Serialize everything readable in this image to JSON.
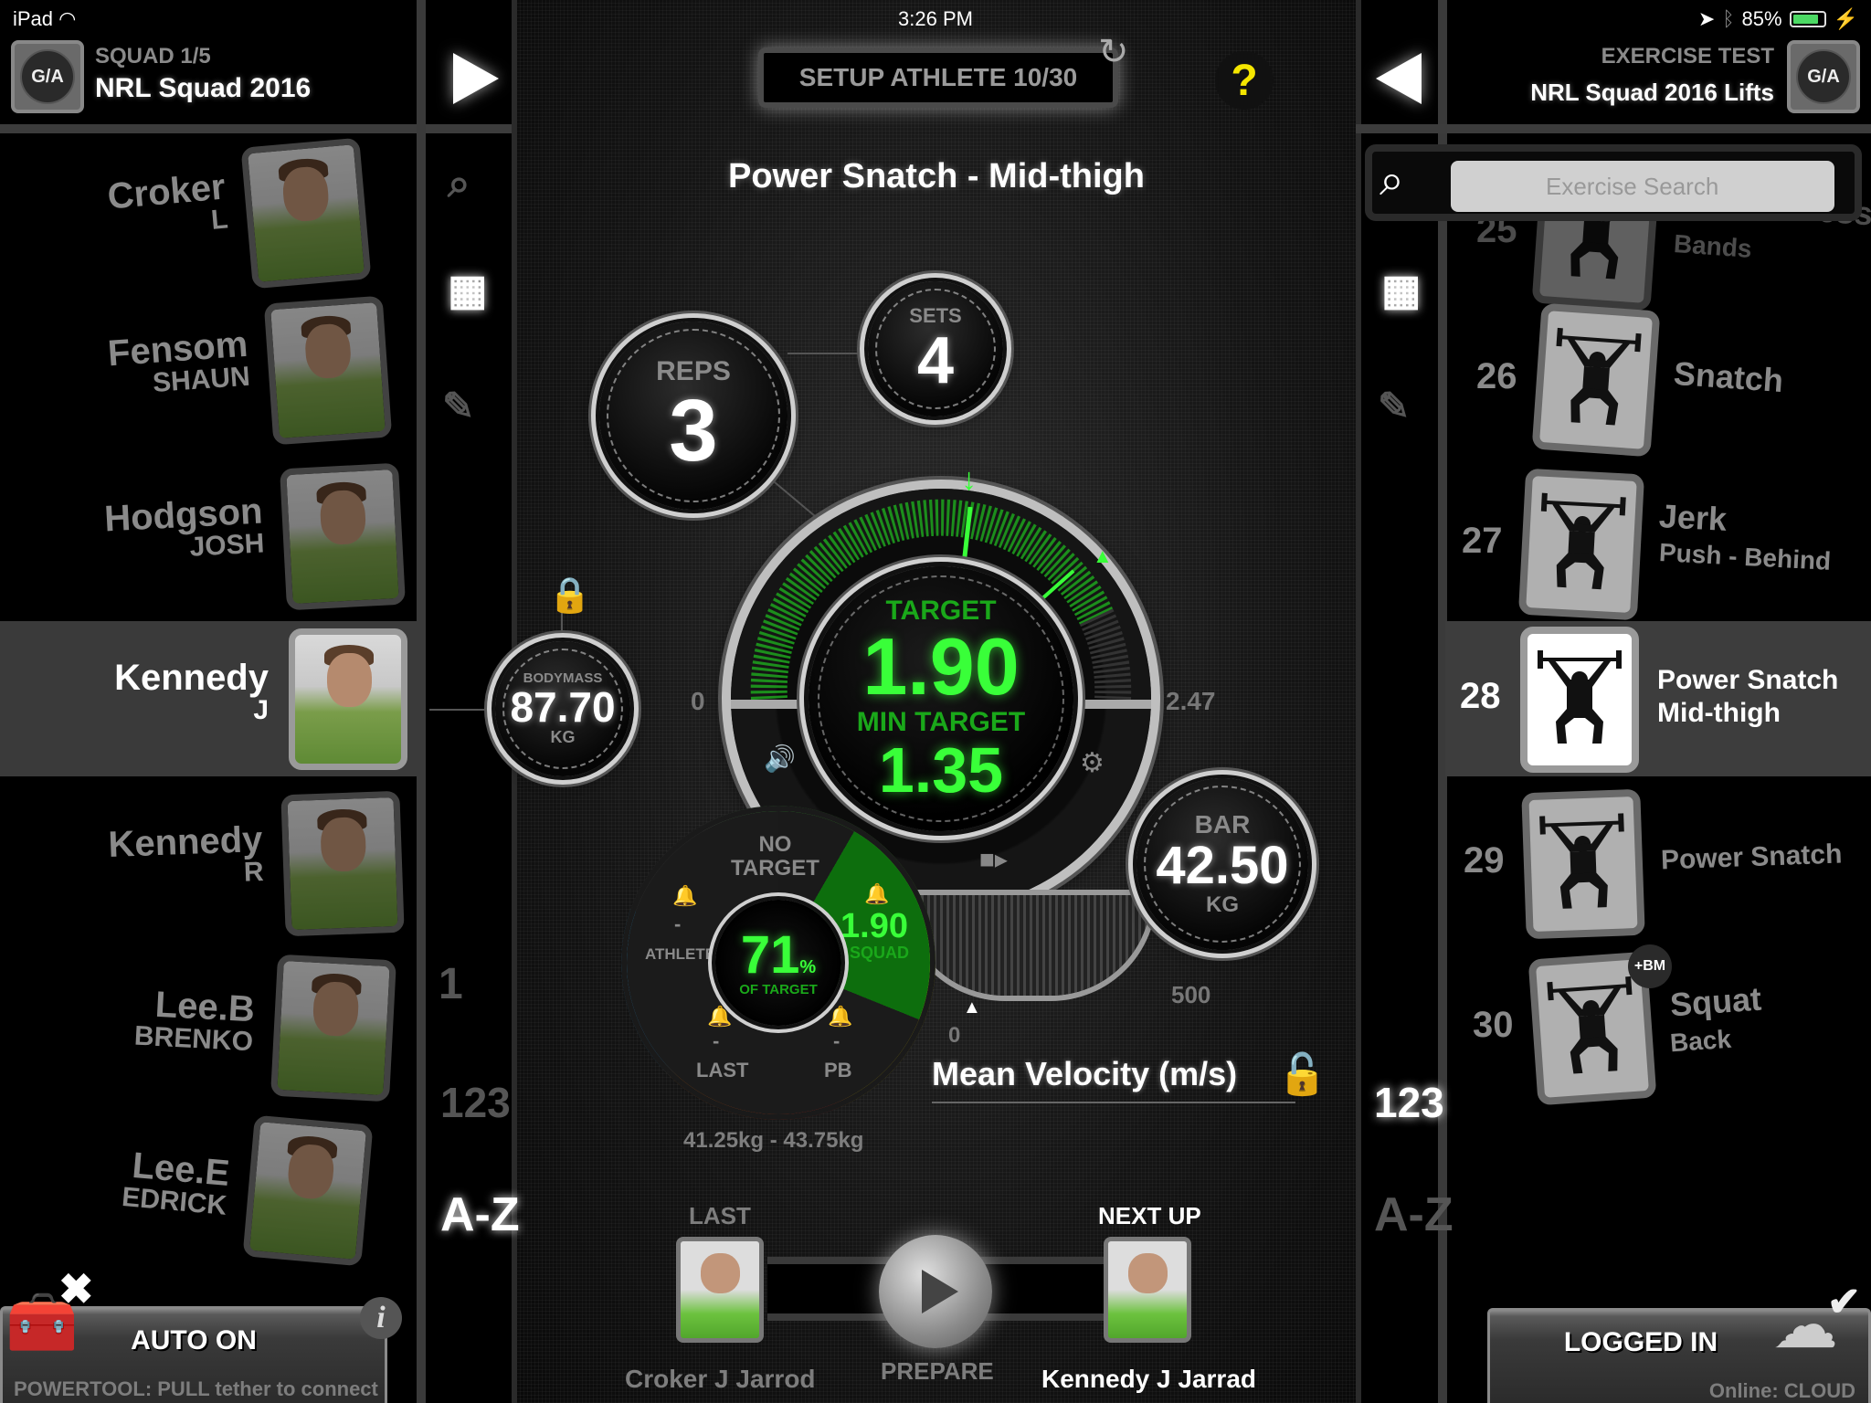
{
  "status_bar": {
    "device": "iPad",
    "time": "3:26 PM",
    "battery_percent": "85%",
    "battery_level": 0.85,
    "icons": [
      "wifi-icon",
      "location-icon",
      "bluetooth-icon",
      "battery-icon",
      "charging-icon"
    ]
  },
  "left_header": {
    "logo": "G/A",
    "subtitle": "SQUAD 1/5",
    "title": "NRL Squad 2016"
  },
  "right_header": {
    "logo": "G/A",
    "subtitle": "EXERCISE TEST",
    "title": "NRL Squad 2016 Lifts"
  },
  "athletes": [
    {
      "surname": "Croker",
      "given": "L",
      "selected": false
    },
    {
      "surname": "Fensom",
      "given": "SHAUN",
      "selected": false
    },
    {
      "surname": "Hodgson",
      "given": "JOSH",
      "selected": false
    },
    {
      "surname": "Kennedy",
      "given": "J",
      "selected": true
    },
    {
      "surname": "Kennedy",
      "given": "R",
      "selected": false
    },
    {
      "surname": "Lee.B",
      "given": "BRENKO",
      "selected": false
    },
    {
      "surname": "Lee.E",
      "given": "EDRICK",
      "selected": false
    }
  ],
  "left_tools": {
    "search": "search-icon",
    "grid": "grid-view-icon",
    "edit": "edit-list-icon",
    "jersey_number": "1",
    "sort_numeric": "123",
    "sort_alpha": "A-Z"
  },
  "right_tools": {
    "grid": "grid-view-icon",
    "edit": "edit-list-icon",
    "sort_numeric": "123",
    "sort_alpha": "A-Z"
  },
  "setup": {
    "button_label": "SETUP ATHLETE 10/30",
    "help": "?"
  },
  "exercise_title": "Power Snatch - Mid-thigh",
  "reps": {
    "label": "REPS",
    "value": "3"
  },
  "sets": {
    "label": "SETS",
    "value": "4"
  },
  "bodymass": {
    "label": "BODYMASS",
    "value": "87.70",
    "unit": "KG"
  },
  "main_gauge": {
    "target_label": "TARGET",
    "target_value": "1.90",
    "min_target_label": "MIN TARGET",
    "min_target_value": "1.35",
    "scale_min": "0",
    "scale_max": "2.47"
  },
  "bar": {
    "label": "BAR",
    "value": "42.50",
    "unit": "KG",
    "scale_min": "0",
    "scale_max": "500"
  },
  "target_wheel": {
    "percent": "71",
    "percent_sign": "%",
    "percent_label": "OF TARGET",
    "segments": {
      "no_target": "NO\nTARGET",
      "athlete_label": "ATHLETE",
      "athlete_value": "-",
      "squad_label": "SQUAD",
      "squad_value": "1.90",
      "last_label": "LAST",
      "last_value": "-",
      "pb_label": "PB",
      "pb_value": "-"
    },
    "range": "41.25kg - 43.75kg"
  },
  "metric_label": "Mean Velocity (m/s)",
  "bottom_nav": {
    "last_label": "LAST",
    "last_name": "Croker J Jarrod",
    "prepare_label": "PREPARE",
    "next_label": "NEXT UP",
    "next_name": "Kennedy J Jarrad"
  },
  "powertool": {
    "title": "AUTO ON",
    "subtitle": "POWERTOOL: PULL tether to connect",
    "info": "i"
  },
  "login": {
    "title": "LOGGED IN",
    "subtitle": "Online: CLOUD"
  },
  "search": {
    "placeholder": "Exercise Search",
    "value": ""
  },
  "exercises": [
    {
      "num": "25",
      "name": "Bench Press",
      "sub": "Bands",
      "selected": false
    },
    {
      "num": "26",
      "name": "Snatch",
      "sub": "",
      "selected": false
    },
    {
      "num": "27",
      "name": "Jerk",
      "sub": "Push - Behind",
      "selected": false
    },
    {
      "num": "28",
      "name": "Power Snatch",
      "sub": "Mid-thigh",
      "selected": true
    },
    {
      "num": "29",
      "name": "Power Snatch",
      "sub": "",
      "selected": false
    },
    {
      "num": "30",
      "name": "Squat",
      "sub": "Back",
      "selected": false,
      "badge": "+BM"
    }
  ]
}
